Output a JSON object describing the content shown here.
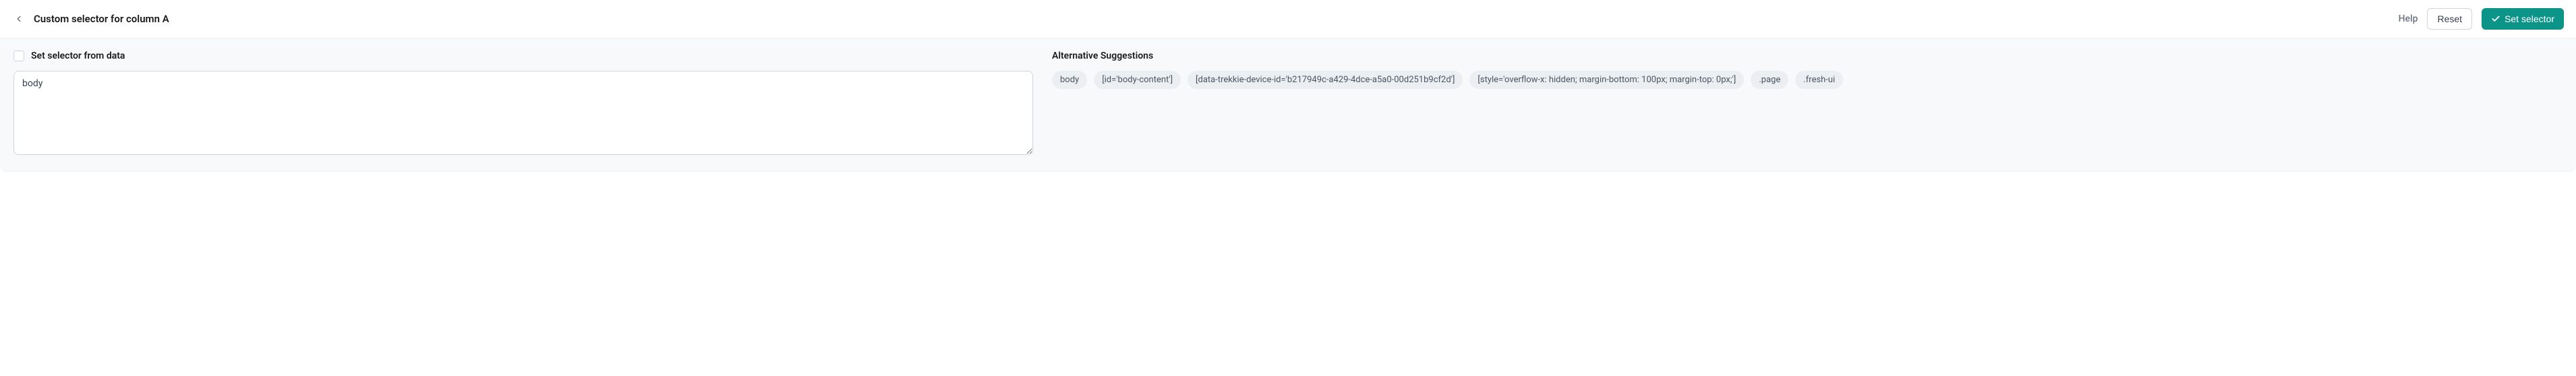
{
  "header": {
    "title": "Custom selector for column A",
    "help_label": "Help",
    "reset_label": "Reset",
    "set_label": "Set selector"
  },
  "editor": {
    "checkbox_label": "Set selector from data",
    "textarea_value": "body"
  },
  "suggestions": {
    "title": "Alternative Suggestions",
    "items": [
      "body",
      "[id='body-content']",
      "[data-trekkie-device-id='b217949c-a429-4dce-a5a0-00d251b9cf2d']",
      "[style='overflow-x: hidden; margin-bottom: 100px; margin-top: 0px;']",
      ".page",
      ".fresh-ui"
    ]
  }
}
